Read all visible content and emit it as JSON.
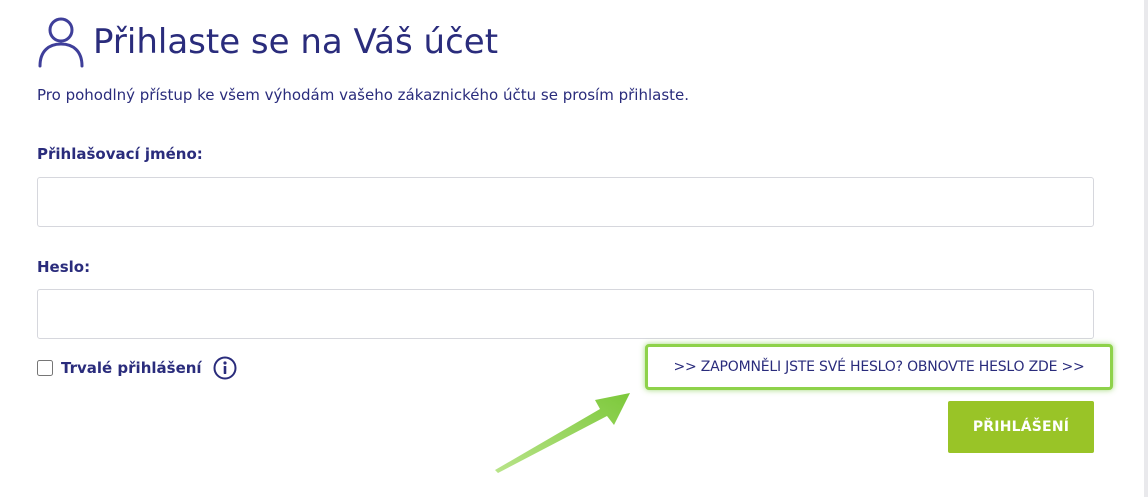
{
  "header": {
    "icon": "user-icon",
    "title": "Přihlaste se na Váš účet",
    "subtitle": "Pro pohodlný přístup ke všem výhodám vašeho zákaznického účtu se prosím přihlaste."
  },
  "form": {
    "username_label": "Přihlašovací jméno:",
    "username_value": "",
    "password_label": "Heslo:",
    "password_value": "",
    "remember_label": "Trvalé přihlášení",
    "remember_checked": false,
    "info_icon": "info-icon",
    "forgot_link": ">> ZAPOMNĚLI JSTE SVÉ HESLO? OBNOVTE HESLO ZDE >>",
    "login_button": "PŘIHLÁŠENÍ"
  },
  "annotation": {
    "arrow_icon": "arrow-icon",
    "highlight_color": "#8ed24a"
  },
  "colors": {
    "text": "#2a2c7c",
    "button": "#99c427",
    "input_border": "#d6d7dd"
  }
}
